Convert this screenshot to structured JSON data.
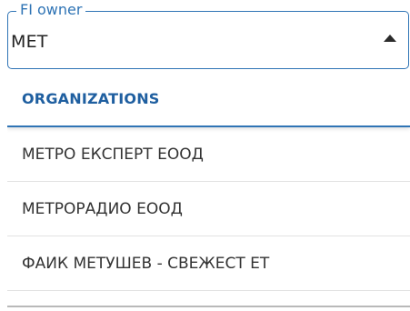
{
  "field": {
    "label": "FI owner",
    "value": "МЕТ",
    "toggle_icon": "caret-up-icon"
  },
  "dropdown": {
    "group_header": "ORGANIZATIONS",
    "options": [
      {
        "label": "МЕТРО ЕКСПЕРТ ЕООД"
      },
      {
        "label": "МЕТРОРАДИО ЕООД"
      },
      {
        "label": "ФАИК МЕТУШЕВ - СВЕЖЕСТ ЕТ"
      }
    ]
  },
  "colors": {
    "accent": "#2f74b5",
    "header_text": "#1f5fa0",
    "option_text": "#333333",
    "divider": "#e2e2e2"
  }
}
